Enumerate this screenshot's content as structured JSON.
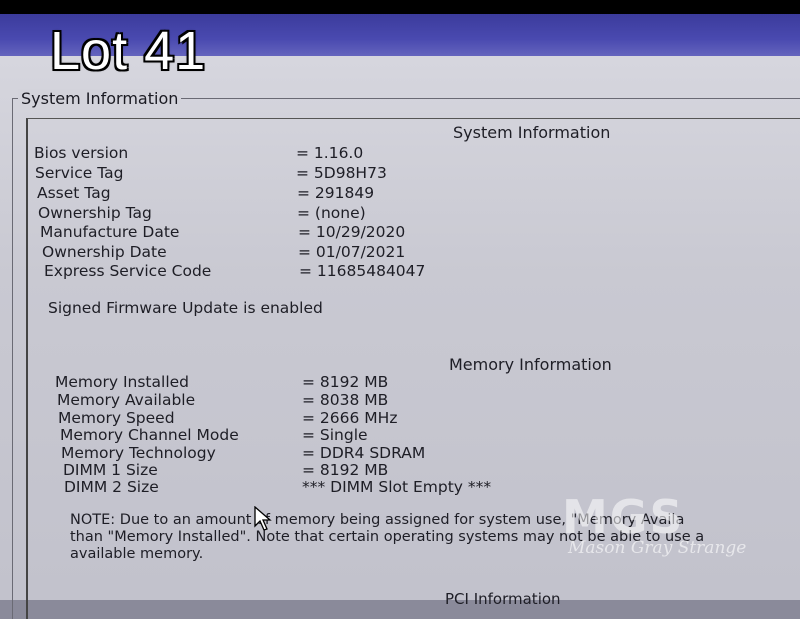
{
  "overlay": {
    "lot_label": "Lot 41"
  },
  "window": {
    "group_title": "System Information"
  },
  "system": {
    "heading": "System Information",
    "rows": [
      {
        "label": "Bios version",
        "value": "= 1.16.0"
      },
      {
        "label": "Service Tag",
        "value": "= 5D98H73"
      },
      {
        "label": "Asset Tag",
        "value": "= 291849"
      },
      {
        "label": "Ownership Tag",
        "value": "= (none)"
      },
      {
        "label": "Manufacture Date",
        "value": "= 10/29/2020"
      },
      {
        "label": "Ownership Date",
        "value": "= 01/07/2021"
      },
      {
        "label": "Express Service Code",
        "value": "= 11685484047"
      }
    ],
    "firmware_status": "Signed Firmware Update is enabled"
  },
  "memory": {
    "heading": "Memory Information",
    "rows": [
      {
        "label": "Memory Installed",
        "value": "= 8192 MB"
      },
      {
        "label": "Memory Available",
        "value": "= 8038 MB"
      },
      {
        "label": "Memory Speed",
        "value": "= 2666 MHz"
      },
      {
        "label": "Memory Channel Mode",
        "value": "= Single"
      },
      {
        "label": "Memory Technology",
        "value": "= DDR4 SDRAM"
      },
      {
        "label": "DIMM 1 Size",
        "value": "= 8192 MB"
      },
      {
        "label": "DIMM 2 Size",
        "value": "*** DIMM Slot Empty ***"
      }
    ],
    "note_lines": [
      "NOTE: Due to an amount of memory being assigned for system use, \"Memory Availa",
      "than \"Memory Installed\". Note that certain operating systems may not be able to use a",
      "available memory."
    ]
  },
  "pci": {
    "heading": "PCI Information"
  },
  "watermark": {
    "logo": "MGS",
    "text": "Mason Gray Strange"
  },
  "icons": {
    "cursor": "mouse-pointer-icon"
  }
}
